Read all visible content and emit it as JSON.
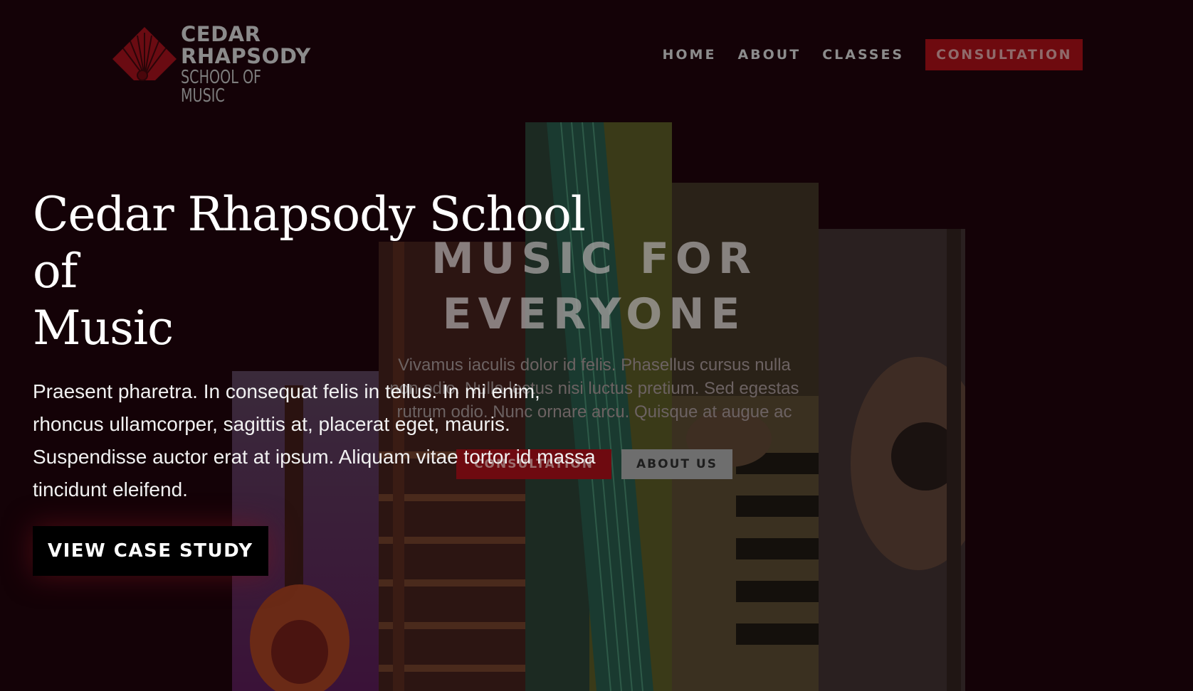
{
  "site": {
    "logo": {
      "line1": "CEDAR",
      "line2": "RHAPSODY",
      "line3": "SCHOOL OF MUSIC",
      "icon": "fan-logo-icon"
    },
    "nav": {
      "items": [
        {
          "label": "HOME"
        },
        {
          "label": "ABOUT"
        },
        {
          "label": "CLASSES"
        }
      ],
      "cta_label": "CONSULTATION"
    },
    "hero": {
      "heading_line1": "MUSIC FOR",
      "heading_line2": "EVERYONE",
      "subtext": "Vivamus iaculis dolor id felis. Phasellus cursus nulla non odio. Nulla lectus nisi luctus pretium. Sed egestas rutrum odio. Nunc ornare arcu. Quisque at augue ac",
      "primary_button": "CONSULTATION",
      "secondary_button": "ABOUT US"
    }
  },
  "case_study": {
    "title_line1": "Cedar Rhapsody School of",
    "title_line2": "Music",
    "description": "Praesent pharetra. In consequat felis in tellus. In mi enim, rhoncus ullamcorper, sagittis at, placerat eget, mauris. Suspendisse auctor erat at ipsum. Aliquam vitae tortor id massa tincidunt eleifend.",
    "button_label": "VIEW CASE STUDY"
  },
  "colors": {
    "background": "#140207",
    "brand_red": "#6e0a0f",
    "overlay_text": "#ffffff"
  }
}
